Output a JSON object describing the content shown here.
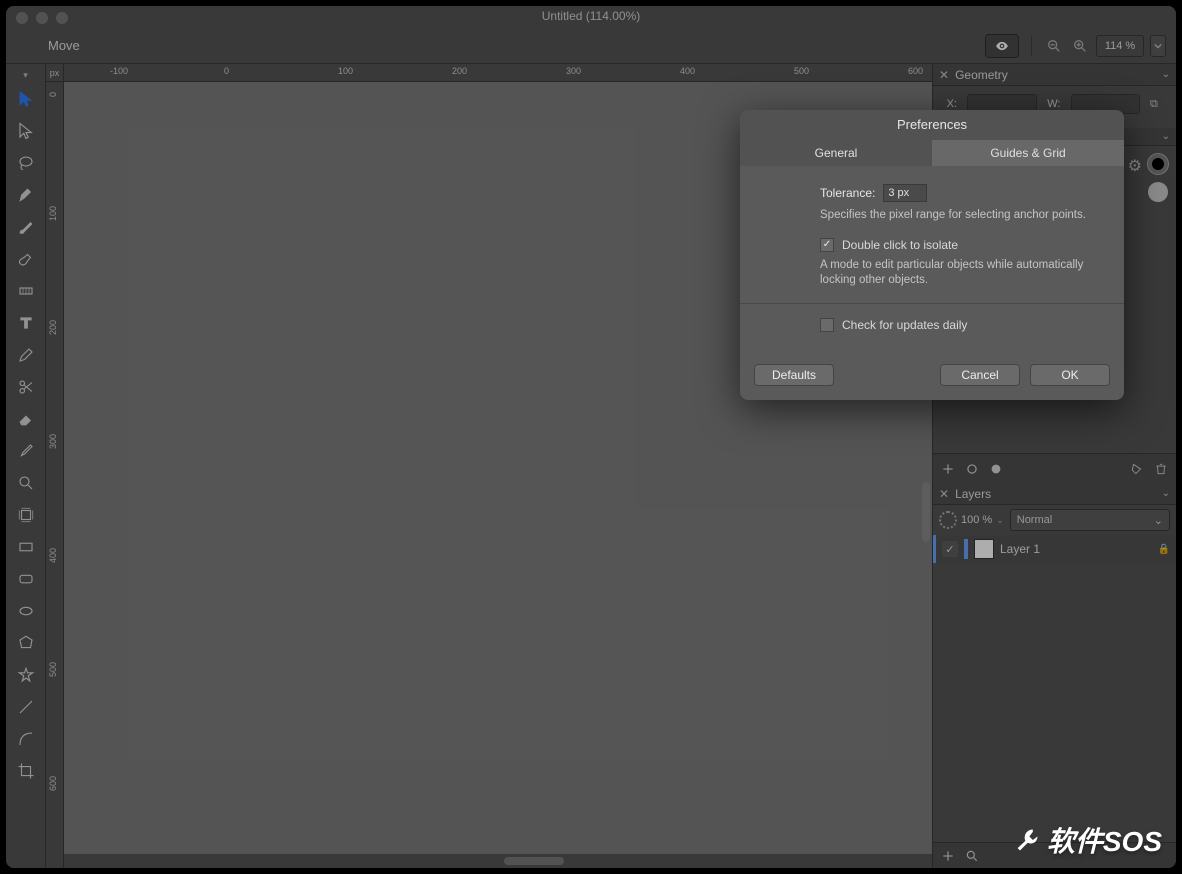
{
  "window": {
    "title": "Untitled (114.00%)"
  },
  "options": {
    "tool": "Move",
    "zoom": "114 %"
  },
  "ruler": {
    "unit": "px",
    "h": [
      "-100",
      "0",
      "100",
      "200",
      "300",
      "400",
      "500",
      "600"
    ],
    "v": [
      "0",
      "100",
      "200",
      "300",
      "400",
      "500",
      "600"
    ]
  },
  "panels": {
    "geometry": {
      "title": "Geometry",
      "xlab": "X:",
      "wlab": "W:"
    },
    "appearance": {
      "hidden_title": ""
    },
    "layers": {
      "title": "Layers",
      "opacity": "100 %",
      "blend": "Normal",
      "layer1": "Layer 1"
    }
  },
  "modal": {
    "title": "Preferences",
    "tabs": {
      "general": "General",
      "guides": "Guides & Grid"
    },
    "tolerance_label": "Tolerance:",
    "tolerance_value": "3 px",
    "tolerance_desc": "Specifies the pixel range for selecting anchor points.",
    "dbl_label": "Double click to isolate",
    "dbl_desc": "A mode to edit particular objects while automatically locking other objects.",
    "updates_label": "Check for updates daily",
    "defaults": "Defaults",
    "cancel": "Cancel",
    "ok": "OK"
  },
  "watermark": "软件SOS"
}
